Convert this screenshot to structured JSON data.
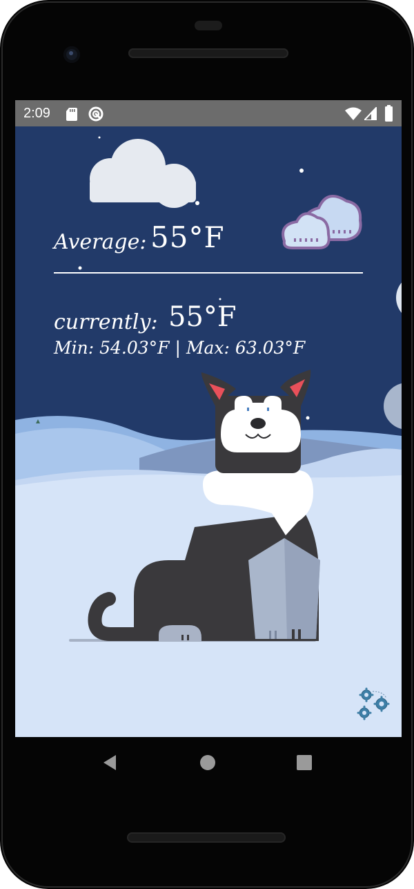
{
  "status_bar": {
    "time": "2:09",
    "icons": [
      "sd-card-icon",
      "sync-icon",
      "wifi-icon",
      "signal-icon",
      "battery-icon"
    ]
  },
  "weather": {
    "average_label": "Average:",
    "average_value": "55°F",
    "current_label": "currently:",
    "current_value": "55°F",
    "min_label": "Min:",
    "min_value": "54.03°F",
    "separator": "|",
    "max_label": "Max:",
    "max_value": "63.03°F"
  },
  "settings": {
    "icon": "gear-icon"
  },
  "navigation": {
    "buttons": [
      "back-icon",
      "home-icon",
      "recents-icon"
    ]
  },
  "colors": {
    "sky": "#223a69",
    "status_bar": "#6c6c6c",
    "snow": "#d6e4f8",
    "dog": "#3a393c",
    "scarf": "#ffffff"
  }
}
